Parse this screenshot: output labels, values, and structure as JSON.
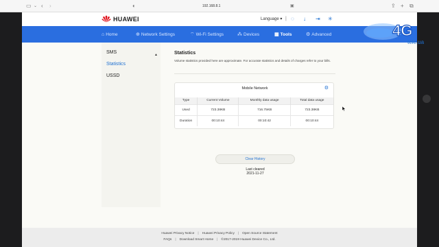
{
  "browser": {
    "url": "192.168.8.1",
    "icons": [
      "sidebar-icon",
      "back-icon",
      "forward-icon",
      "shield-icon",
      "reader-icon",
      "share-icon",
      "new-tab-icon",
      "tabs-icon"
    ]
  },
  "header": {
    "brand": "HUAWEI",
    "language": "Language",
    "icons": [
      "messages-icon",
      "download-icon",
      "logout-icon",
      "loading-icon"
    ]
  },
  "nav": [
    {
      "label": "Home",
      "icon": "home-icon"
    },
    {
      "label": "Network Settings",
      "icon": "globe-icon"
    },
    {
      "label": "Wi-Fi Settings",
      "icon": "wifi-icon"
    },
    {
      "label": "Devices",
      "icon": "devices-icon"
    },
    {
      "label": "Tools",
      "icon": "tools-icon",
      "active": true
    },
    {
      "label": "Advanced",
      "icon": "advanced-icon"
    }
  ],
  "sidebar": {
    "items": [
      {
        "label": "SMS"
      },
      {
        "label": "Statistics",
        "active": true
      },
      {
        "label": "USSD"
      }
    ]
  },
  "main": {
    "title": "Statistics",
    "description": "Volume statistics provided here are approximate. For accurate statistics and details of charges refer to your bills.",
    "card_title": "Mobile Network",
    "columns": [
      "Type",
      "Current Volume",
      "Monthly data usage",
      "Total data usage"
    ],
    "rows": [
      [
        "Used",
        "723.38KB",
        "716.75KB",
        "723.38KB"
      ],
      [
        "Duration",
        "00:10:44",
        "00:10:42",
        "00:10:44"
      ]
    ],
    "clear_button": "Clear History",
    "last_cleared_label": "Last cleared",
    "last_cleared_date": "2021-11-27"
  },
  "footer": {
    "row1": [
      "Huawei Privacy Notice",
      "Huawei Privacy Policy",
      "Open Source Statement"
    ],
    "row2": [
      "FAQs",
      "Download Smart Home",
      "©2017-2019 Huawei Device Co., Ltd."
    ]
  },
  "watermark": {
    "text": "4G",
    "sub": "tele.ua"
  },
  "colors": {
    "nav": "#2a6ee0",
    "accent": "#1f70d1",
    "logo": "#e0141e"
  }
}
